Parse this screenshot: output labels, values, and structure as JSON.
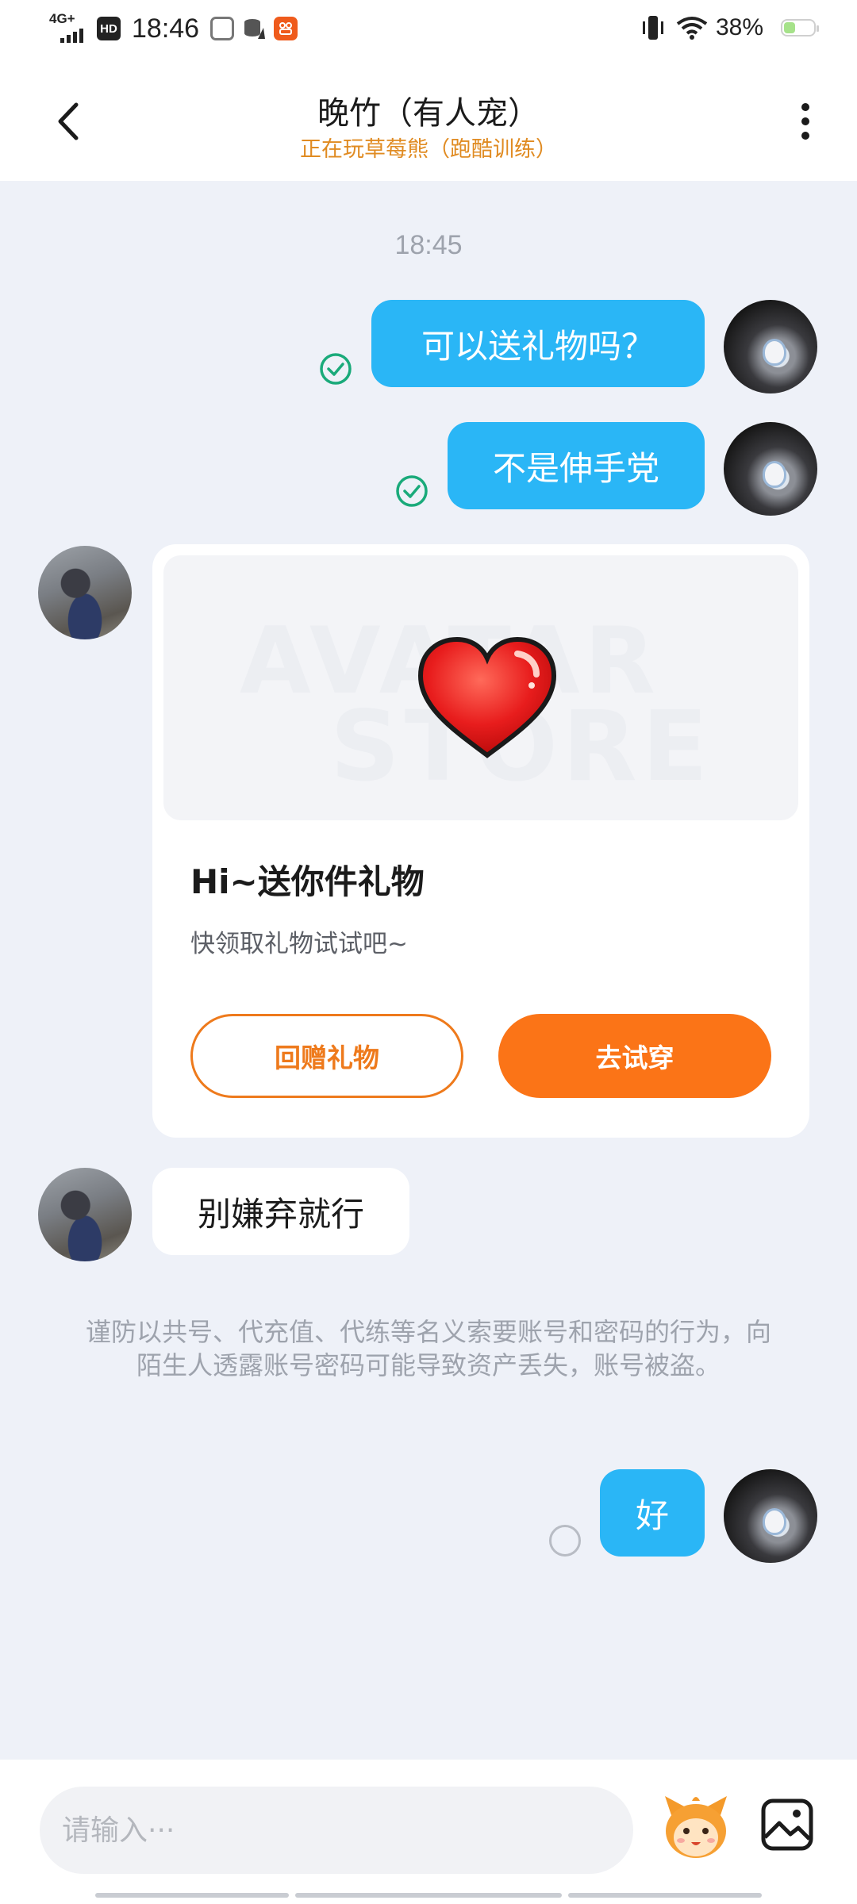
{
  "status_bar": {
    "network": "4G+",
    "hd": "HD",
    "time": "18:46",
    "battery_text": "38%",
    "battery_level": 0.38
  },
  "header": {
    "title": "晚竹（有人宠）",
    "subtitle": "正在玩草莓熊（跑酷训练）"
  },
  "chat": {
    "timestamp": "18:45",
    "messages": [
      {
        "from": "me",
        "text": "可以送礼物吗？",
        "status": "read"
      },
      {
        "from": "me",
        "text": "不是伸手党",
        "status": "read"
      },
      {
        "from": "other",
        "type": "gift",
        "gift": {
          "watermark_top": "AVATAR",
          "watermark_bottom": "STORE",
          "title": "Hi~送你件礼物",
          "description": "快领取礼物试试吧~",
          "return_button": "回赠礼物",
          "try_button": "去试穿"
        }
      },
      {
        "from": "other",
        "text": "别嫌弃就行"
      },
      {
        "from": "me",
        "text": "好",
        "status": "sending"
      }
    ],
    "notice": "谨防以共号、代充值、代练等名义索要账号和密码的行为，向陌生人透露账号密码可能导致资产丢失，账号被盗。"
  },
  "input": {
    "placeholder": "请输入···"
  },
  "colors": {
    "outgoing_bubble": "#2ab6f6",
    "accent_orange": "#fb7417",
    "subtitle_orange": "#e08b22",
    "read_check": "#1aaa7a"
  }
}
